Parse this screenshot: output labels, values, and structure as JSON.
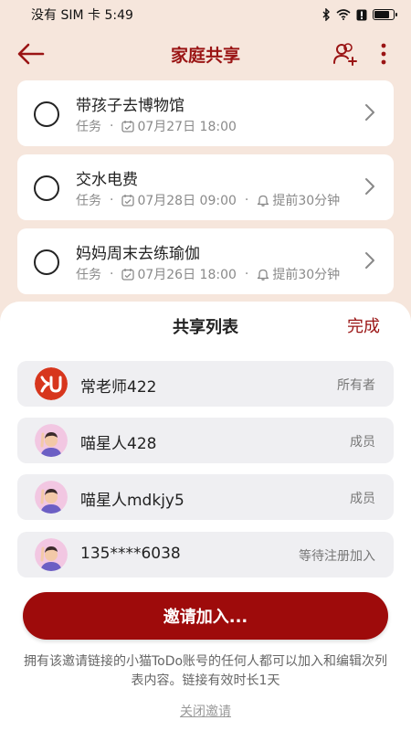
{
  "status_bar": {
    "carrier_time": "没有 SIM 卡 5:49",
    "icons": [
      "bluetooth-icon",
      "wifi-icon",
      "alert-icon",
      "battery-icon"
    ]
  },
  "header": {
    "title": "家庭共享",
    "icons": [
      "back-arrow-icon",
      "add-member-icon",
      "more-icon"
    ]
  },
  "tasks": [
    {
      "title": "带孩子去博物馆",
      "type": "任务",
      "date": "07月27日 18:00",
      "reminder": ""
    },
    {
      "title": "交水电费",
      "type": "任务",
      "date": "07月28日 09:00",
      "reminder": "提前30分钟"
    },
    {
      "title": "妈妈周末去练瑜伽",
      "type": "任务",
      "date": "07月26日 18:00",
      "reminder": "提前30分钟"
    }
  ],
  "sheet": {
    "title": "共享列表",
    "done_label": "完成",
    "members": [
      {
        "name": "常老师422",
        "role": "所有者",
        "avatar": "owner-logo"
      },
      {
        "name": "喵星人428",
        "role": "成员",
        "avatar": "cartoon"
      },
      {
        "name": "喵星人mdkjy5",
        "role": "成员",
        "avatar": "cartoon"
      },
      {
        "name": "135****6038",
        "role": "等待注册加入",
        "avatar": "cartoon"
      }
    ],
    "invite_label": "邀请加入...",
    "invite_note": "拥有该邀请链接的小猫ToDo账号的任何人都可以加入和编辑次列表内容。链接有效时长1天",
    "close_invite_label": "关闭邀请"
  },
  "colors": {
    "accent": "#9a1414",
    "button": "#9e0b0b",
    "page_background": "#f6e6dc",
    "row_background": "#efeff2"
  }
}
